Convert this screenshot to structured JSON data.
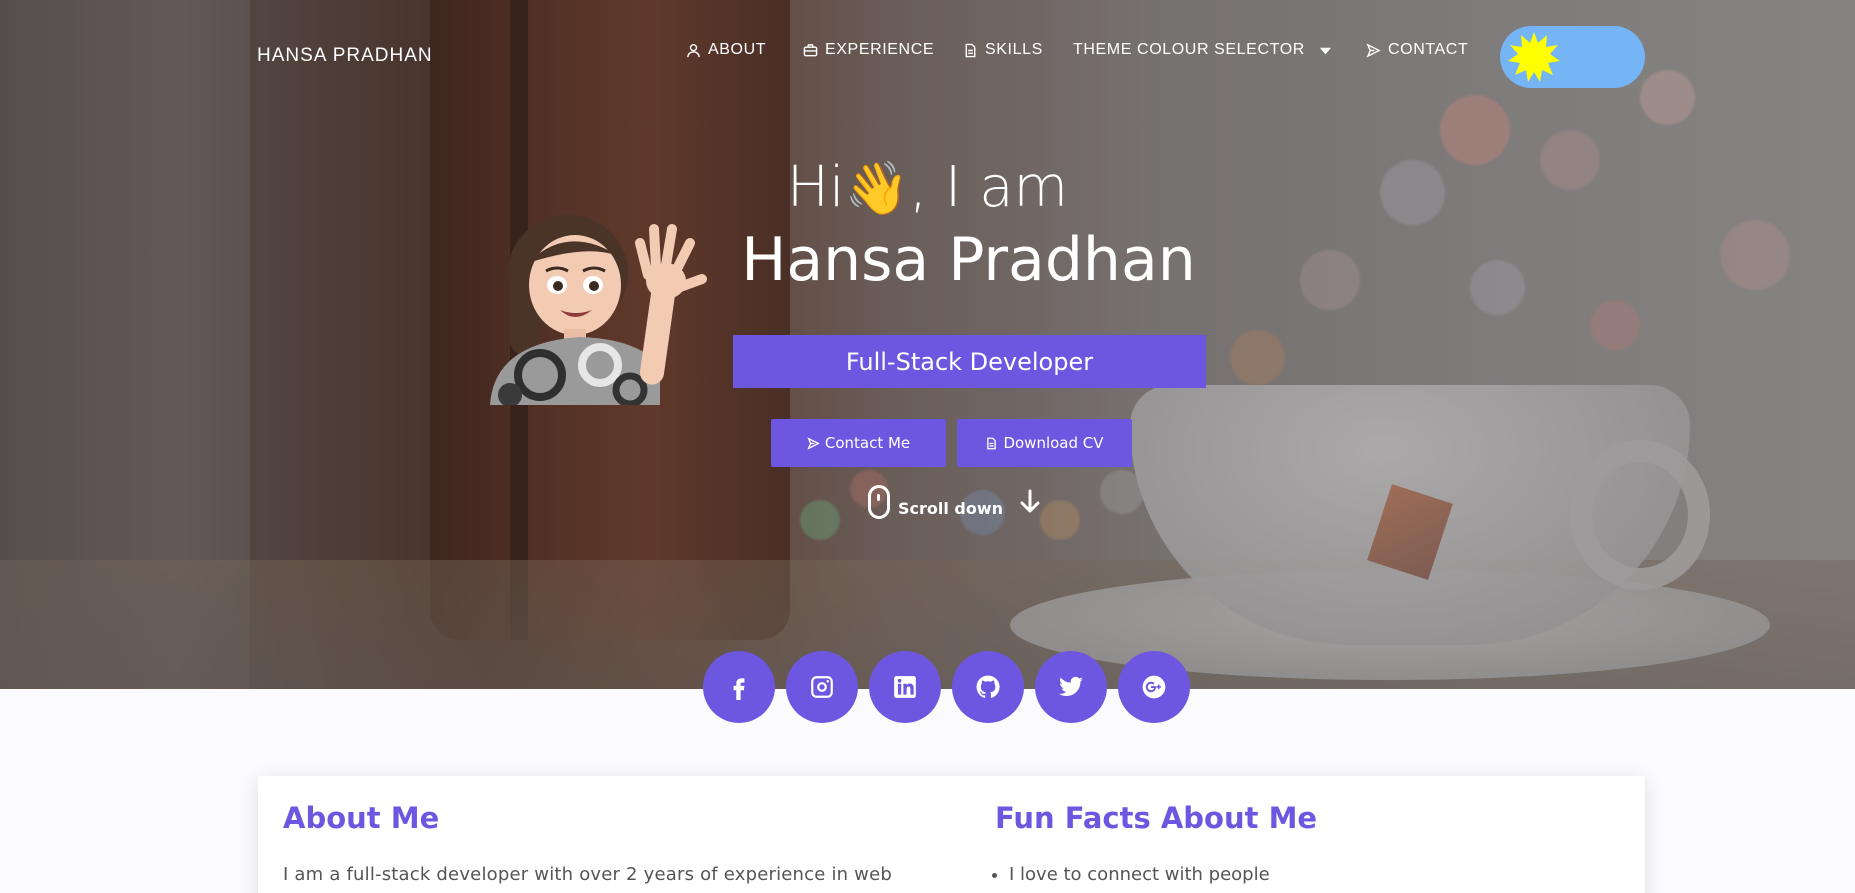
{
  "nav": {
    "brand": "HANSA PRADHAN",
    "items": [
      {
        "label": "ABOUT",
        "icon": "user-icon"
      },
      {
        "label": "EXPERIENCE",
        "icon": "briefcase-icon"
      },
      {
        "label": "SKILLS",
        "icon": "document-icon"
      },
      {
        "label": "THEME COLOUR SELECTOR",
        "icon": "caret-down-icon"
      },
      {
        "label": "CONTACT",
        "icon": "send-icon"
      }
    ],
    "theme_toggle": {
      "state": "light",
      "icon": "sun-icon"
    }
  },
  "hero": {
    "greeting_prefix": "Hi",
    "greeting_emoji": "👋",
    "greeting_suffix": ", I am",
    "name": "Hansa Pradhan",
    "role": "Full-Stack Developer",
    "buttons": {
      "contact": "Contact Me",
      "download": "Download CV"
    },
    "scroll_label": "Scroll down"
  },
  "social": [
    "facebook-icon",
    "instagram-icon",
    "linkedin-icon",
    "github-icon",
    "twitter-icon",
    "google-plus-icon"
  ],
  "about": {
    "title": "About Me",
    "text": "I am a full-stack developer with over 2 years of experience in web"
  },
  "fun_facts": {
    "title": "Fun Facts About Me",
    "items": [
      "I love to connect with people"
    ]
  },
  "colors": {
    "accent": "#6e57e0",
    "toggle_bg": "#75b4f5",
    "sun": "#ffff00"
  }
}
